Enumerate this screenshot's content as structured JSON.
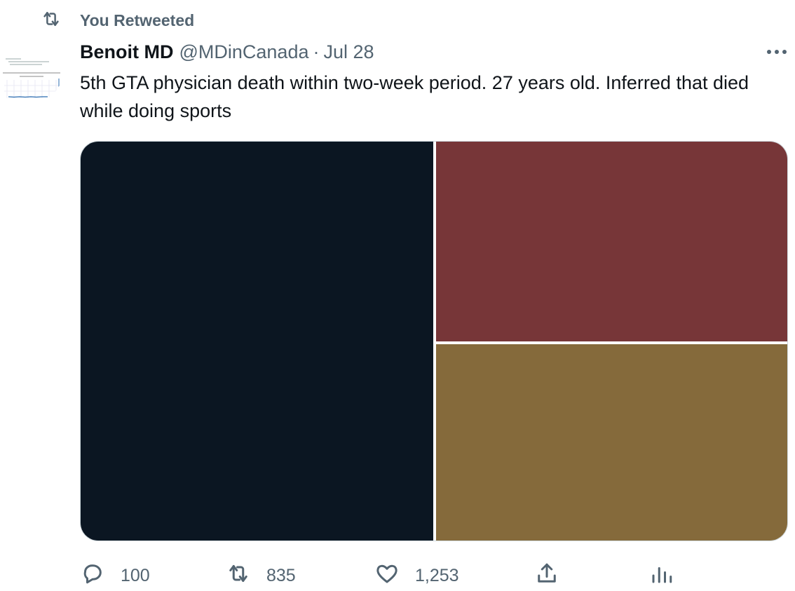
{
  "retweet_banner": {
    "icon": "retweet-icon",
    "text": "You Retweeted"
  },
  "author": {
    "name": "Benoit MD",
    "handle": "@MDinCanada",
    "separator": "·",
    "date": "Jul 28",
    "avatar": "chart-avatar"
  },
  "tweet": {
    "text": "5th GTA physician death within two-week period. 27 years old. Inferred that died while doing sports"
  },
  "media": {
    "tiles": [
      {
        "color": "#0b1622"
      },
      {
        "color": "#773638"
      },
      {
        "color": "#856a3b"
      }
    ]
  },
  "actions": {
    "reply": {
      "icon": "reply-icon",
      "count": "100"
    },
    "retweet": {
      "icon": "retweet-icon",
      "count": "835"
    },
    "like": {
      "icon": "heart-icon",
      "count": "1,253"
    },
    "share": {
      "icon": "share-icon"
    },
    "analytics": {
      "icon": "analytics-icon"
    }
  },
  "colors": {
    "secondary_text": "#536471",
    "primary_text": "#0f1419",
    "border": "#cfd9de"
  }
}
